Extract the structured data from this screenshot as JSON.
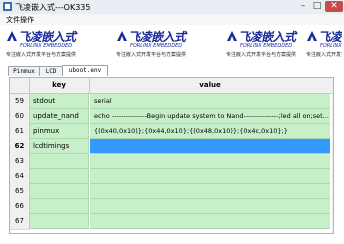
{
  "window": {
    "title": "飞凌嵌入式---OK335",
    "minimize": "–",
    "maximize": "□",
    "close": "✕"
  },
  "menu": {
    "file_ops": "文件操作"
  },
  "banner": {
    "logo_cn": "飞凌嵌入式",
    "logo_en": "FORLINX EMBEDDED",
    "slogan": "专注嵌入式开发平台与方案提供"
  },
  "tabs": [
    {
      "label": "Pinmux"
    },
    {
      "label": "LCD"
    },
    {
      "label": "uboot.env"
    }
  ],
  "grid": {
    "col_key": "key",
    "col_value": "value",
    "rows": [
      {
        "num": "59",
        "key": "stdout",
        "value": "serial"
      },
      {
        "num": "60",
        "key": "update_nand",
        "value": "echo ---------------Begin update system to Nand---------------;led all on;set..."
      },
      {
        "num": "61",
        "key": "pinmux",
        "value": "{(0x40,0x10)};{0x44,0x10};{(0x48,0x10)};{0x4c,0x10};}"
      },
      {
        "num": "62",
        "key": "lcdtimings",
        "value": ""
      },
      {
        "num": "63",
        "key": "",
        "value": ""
      },
      {
        "num": "64",
        "key": "",
        "value": ""
      },
      {
        "num": "65",
        "key": "",
        "value": ""
      },
      {
        "num": "66",
        "key": "",
        "value": ""
      },
      {
        "num": "67",
        "key": "",
        "value": ""
      }
    ]
  },
  "colors": {
    "brand_blue": "#1a2a9b",
    "cell_green": "#c8f0c8",
    "selection_blue": "#3399ff",
    "close_red": "#c74b4b"
  }
}
